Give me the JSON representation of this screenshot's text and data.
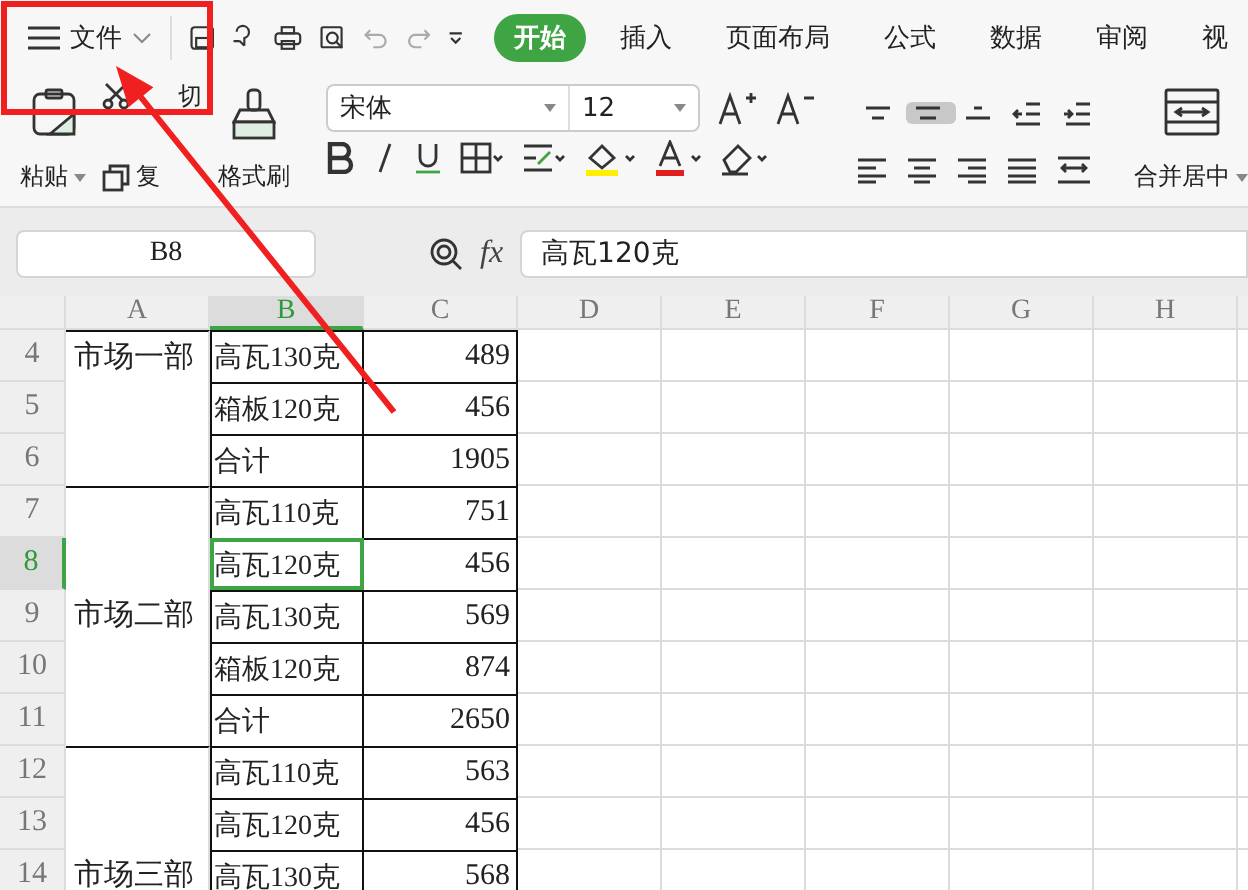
{
  "menu": {
    "label": "文件"
  },
  "tabs": [
    {
      "label": "开始",
      "selected": true
    },
    {
      "label": "插入",
      "selected": false
    },
    {
      "label": "页面布局",
      "selected": false
    },
    {
      "label": "公式",
      "selected": false
    },
    {
      "label": "数据",
      "selected": false
    },
    {
      "label": "审阅",
      "selected": false
    },
    {
      "label": "视",
      "selected": false
    }
  ],
  "clipboard": {
    "paste": "粘贴",
    "cut": "切",
    "copy": "复",
    "format_painter": "格式刷"
  },
  "font": {
    "name": "宋体",
    "size": "12"
  },
  "align_buttons": [
    {
      "kind": "top",
      "selected": false
    },
    {
      "kind": "middle",
      "selected": true
    },
    {
      "kind": "bottom",
      "selected": false
    },
    {
      "kind": "outdent",
      "selected": false
    },
    {
      "kind": "indent",
      "selected": false
    }
  ],
  "merge": {
    "label": "合并居中"
  },
  "formula_bar": {
    "cell": "B8",
    "function_label": "fx",
    "value": "高瓦120克"
  },
  "columns": [
    {
      "label": "A",
      "selected": false
    },
    {
      "label": "B",
      "selected": true
    },
    {
      "label": "C",
      "selected": false
    },
    {
      "label": "D",
      "selected": false
    },
    {
      "label": "E",
      "selected": false
    },
    {
      "label": "F",
      "selected": false
    },
    {
      "label": "G",
      "selected": false
    },
    {
      "label": "H",
      "selected": false
    }
  ],
  "rows": [
    {
      "number": "4",
      "group_start": true,
      "a": "市场一部",
      "b": "高瓦130克",
      "c": "489",
      "selected": false
    },
    {
      "number": "5",
      "group_start": false,
      "b": "箱板120克",
      "c": "456",
      "selected": false
    },
    {
      "number": "6",
      "group_start": false,
      "b": "合计",
      "c": "1905",
      "selected": false
    },
    {
      "number": "7",
      "group_start": true,
      "b": "高瓦110克",
      "c": "751",
      "selected": false
    },
    {
      "number": "8",
      "group_start": false,
      "b": "高瓦120克",
      "c": "456",
      "selected": true
    },
    {
      "number": "9",
      "group_start": false,
      "a": "市场二部",
      "b": "高瓦130克",
      "c": "569",
      "selected": false
    },
    {
      "number": "10",
      "group_start": false,
      "b": "箱板120克",
      "c": "874",
      "selected": false
    },
    {
      "number": "11",
      "group_start": false,
      "b": "合计",
      "c": "2650",
      "selected": false
    },
    {
      "number": "12",
      "group_start": true,
      "b": "高瓦110克",
      "c": "563",
      "selected": false
    },
    {
      "number": "13",
      "group_start": false,
      "b": "高瓦120克",
      "c": "456",
      "selected": false
    },
    {
      "number": "14",
      "group_start": false,
      "a": "市场三部",
      "b": "高瓦130克",
      "c": "568",
      "selected": false
    }
  ]
}
